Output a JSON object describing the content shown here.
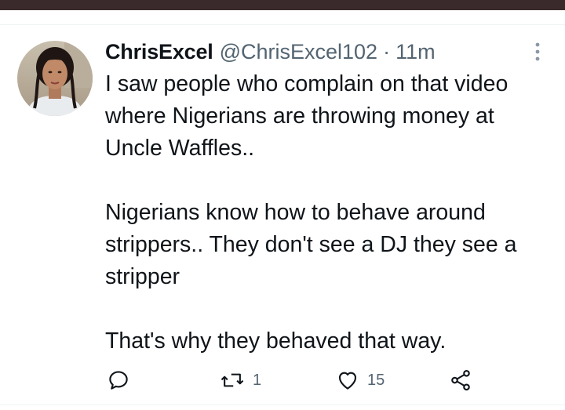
{
  "tweet": {
    "display_name": "ChrisExcel",
    "handle": "@ChrisExcel102",
    "separator": "·",
    "time": "11m",
    "text": "I saw people who complain on that video\nwhere Nigerians are throwing money at\nUncle Waffles..\n\nNigerians know how to behave around\nstrippers.. They don't see a DJ they see a\nstripper\n\nThat's why they behaved that way."
  },
  "actions": {
    "reply_count": "",
    "retweet_count": "1",
    "like_count": "15"
  },
  "icons": {
    "avatar": "profile-photo",
    "more": "more-vertical-icon",
    "reply": "reply-icon",
    "retweet": "retweet-icon",
    "like": "heart-icon",
    "share": "share-icon"
  },
  "colors": {
    "top_bar": "#3a2a2c",
    "text": "#0f1419",
    "secondary": "#536471",
    "divider": "#eff3f4"
  }
}
